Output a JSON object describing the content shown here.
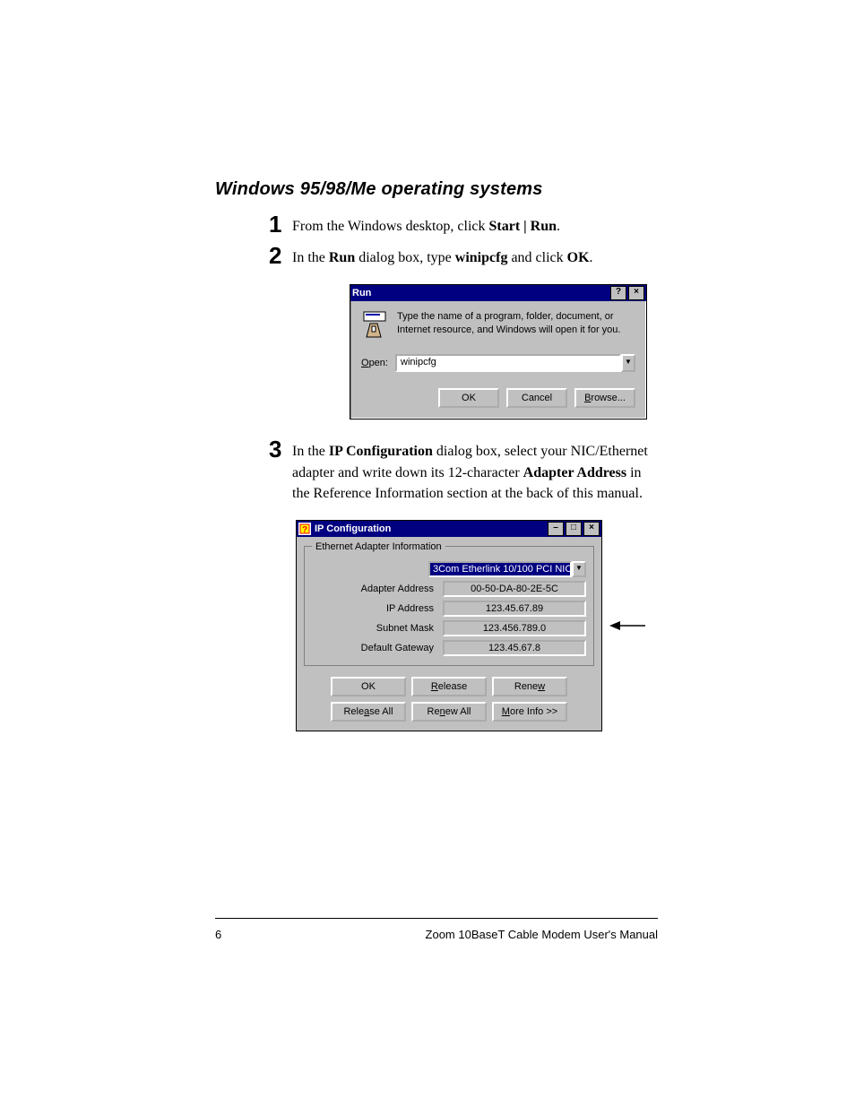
{
  "heading": "Windows 95/98/Me operating systems",
  "steps": {
    "s1_num": "1",
    "s1_pre": "From the Windows desktop, click ",
    "s1_b1": "Start | Run",
    "s1_post": ".",
    "s2_num": "2",
    "s2_pre": "In the ",
    "s2_b1": "Run",
    "s2_mid1": " dialog box, type ",
    "s2_b2": "winipcfg",
    "s2_mid2": " and click ",
    "s2_b3": "OK",
    "s2_post": ".",
    "s3_num": "3",
    "s3_pre": "In the ",
    "s3_b1": "IP Configuration",
    "s3_mid1": " dialog box, select your NIC/Ethernet adapter and write down its 12-character ",
    "s3_b2": "Adapter Address",
    "s3_post": " in the Reference Information section at the back of this manual."
  },
  "run_dialog": {
    "title": "Run",
    "help_btn": "?",
    "close_btn": "×",
    "description": "Type the name of a program, folder, document, or Internet resource, and Windows will open it for you.",
    "open_label_u": "O",
    "open_label_rest": "pen:",
    "open_value": "winipcfg",
    "dropdown_glyph": "▼",
    "btn_ok": "OK",
    "btn_cancel": "Cancel",
    "btn_browse_u": "B",
    "btn_browse_rest": "rowse..."
  },
  "ipc_dialog": {
    "title": "IP Configuration",
    "min_btn": "–",
    "max_btn": "□",
    "close_btn": "×",
    "group_title": "Ethernet Adapter Information",
    "adapter_select": "3Com Etherlink 10/100 PCI NIC",
    "dropdown_glyph": "▼",
    "lbl_adapter_addr": "Adapter Address",
    "val_adapter_addr": "00-50-DA-80-2E-5C",
    "lbl_ip": "IP Address",
    "val_ip": "123.45.67.89",
    "lbl_subnet": "Subnet Mask",
    "val_subnet": "123.456.789.0",
    "lbl_gateway": "Default Gateway",
    "val_gateway": "123.45.67.8",
    "btn_ok": "OK",
    "btn_release_u": "R",
    "btn_release_rest": "elease",
    "btn_renew_rest": "Rene",
    "btn_renew_u": "w",
    "btn_release_all_pre": "Rele",
    "btn_release_all_u": "a",
    "btn_release_all_post": "se All",
    "btn_renew_all_pre": "Re",
    "btn_renew_all_u": "n",
    "btn_renew_all_post": "ew All",
    "btn_more_u": "M",
    "btn_more_rest": "ore Info >>"
  },
  "footer": {
    "page_num": "6",
    "doc_title": "Zoom 10BaseT Cable Modem User's Manual"
  }
}
